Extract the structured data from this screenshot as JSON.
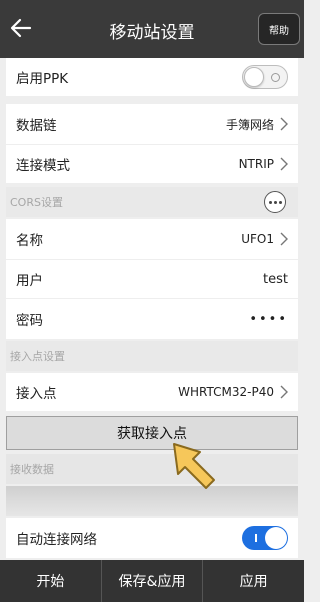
{
  "header": {
    "title": "移动站设置",
    "help_label": "帮助"
  },
  "ppk": {
    "label": "启用PPK",
    "enabled": false
  },
  "datalink": {
    "label": "数据链",
    "value": "手簿网络"
  },
  "connection_mode": {
    "label": "连接模式",
    "value": "NTRIP"
  },
  "cors_section": {
    "title": "CORS设置"
  },
  "name": {
    "label": "名称",
    "value": "UFO1"
  },
  "user": {
    "label": "用户",
    "value": "test"
  },
  "password": {
    "label": "密码",
    "value": "••••"
  },
  "mountpoint_section": {
    "title": "接入点设置"
  },
  "mountpoint": {
    "label": "接入点",
    "value": "WHRTCM32-P40"
  },
  "get_mountpoint_button": "获取接入点",
  "receive_section": {
    "title": "接收数据"
  },
  "auto_connect": {
    "label": "自动连接网络",
    "enabled": true
  },
  "bottom_bar": {
    "start": "开始",
    "save_apply": "保存&应用",
    "apply": "应用"
  },
  "colors": {
    "accent": "#1d6fe0",
    "pointer": "#f6c75a",
    "header_bg": "#3a3a3a"
  }
}
